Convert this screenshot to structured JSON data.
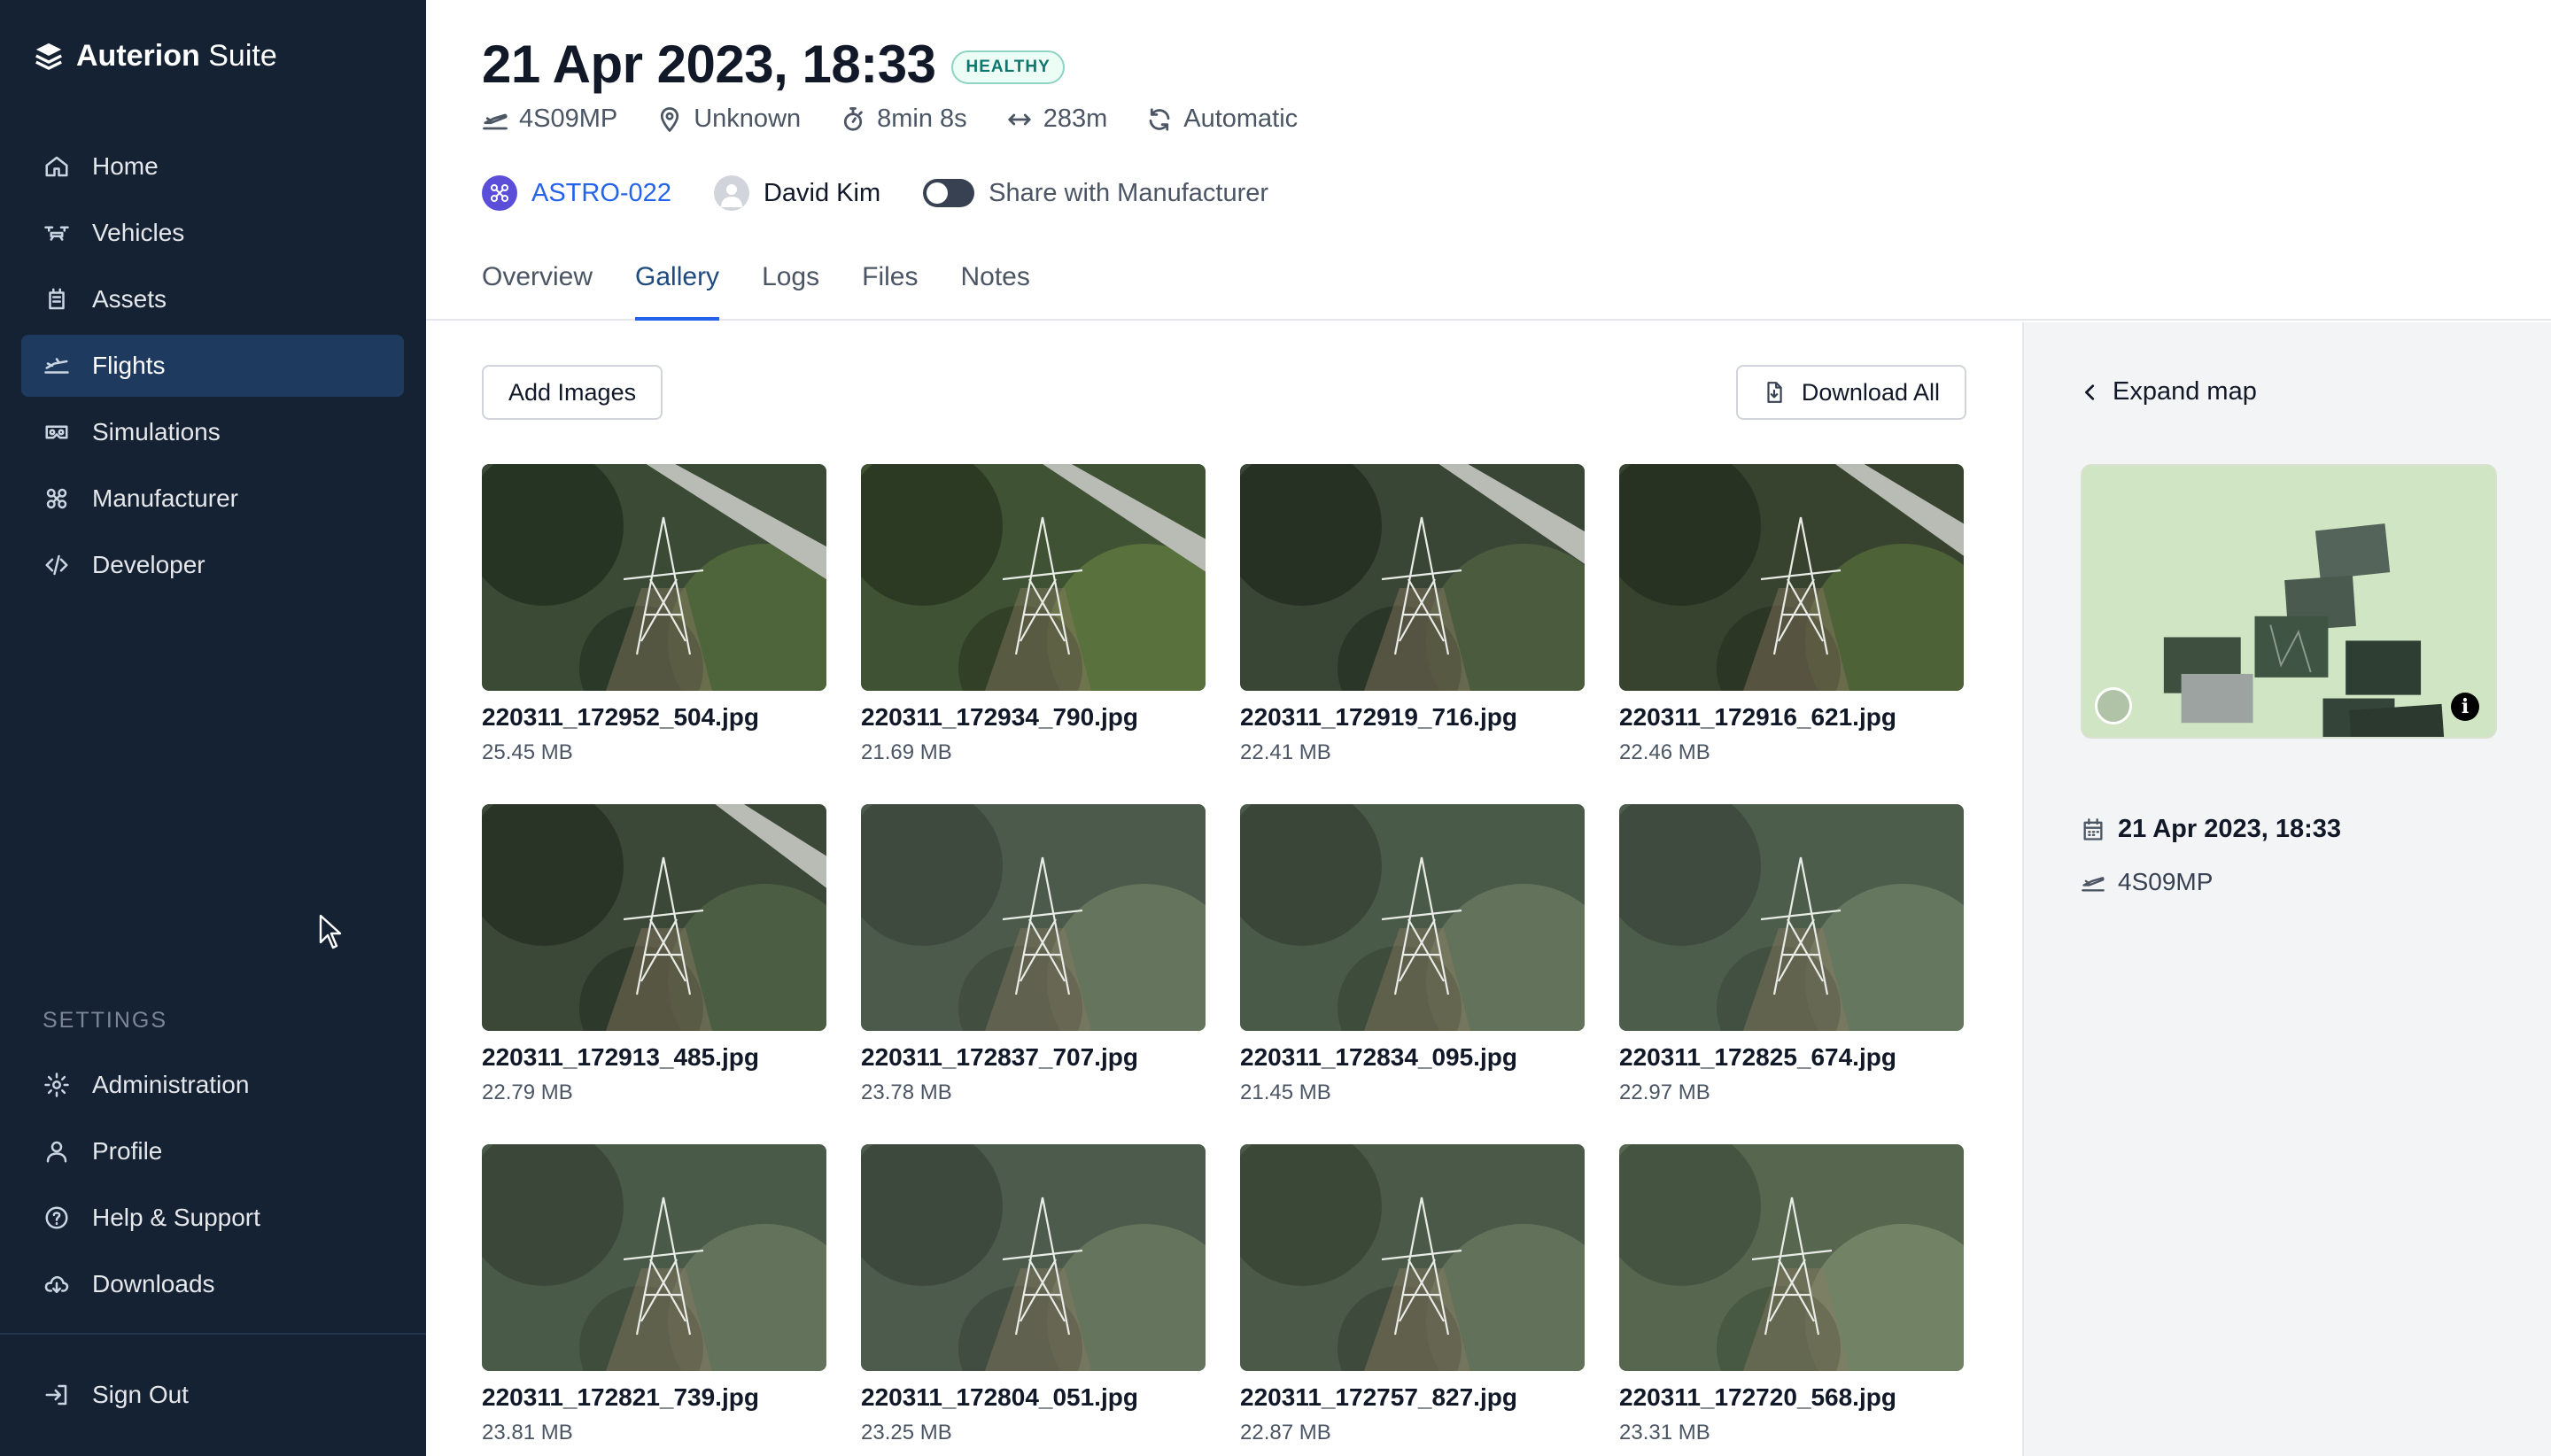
{
  "app": {
    "brand_bold": "Auterion",
    "brand_light": "Suite"
  },
  "sidebar": {
    "main_items": [
      {
        "label": "Home",
        "icon": "home-icon"
      },
      {
        "label": "Vehicles",
        "icon": "drone-icon"
      },
      {
        "label": "Assets",
        "icon": "asset-icon"
      },
      {
        "label": "Flights",
        "icon": "flights-icon",
        "active": true
      },
      {
        "label": "Simulations",
        "icon": "vr-headset-icon"
      },
      {
        "label": "Manufacturer",
        "icon": "grid-icon"
      },
      {
        "label": "Developer",
        "icon": "code-icon"
      }
    ],
    "settings_heading": "SETTINGS",
    "settings_items": [
      {
        "label": "Administration",
        "icon": "gear-icon"
      },
      {
        "label": "Profile",
        "icon": "user-icon"
      },
      {
        "label": "Help & Support",
        "icon": "help-icon"
      },
      {
        "label": "Downloads",
        "icon": "cloud-download-icon"
      }
    ],
    "sign_out": {
      "label": "Sign Out",
      "icon": "sign-out-icon"
    }
  },
  "flight": {
    "title": "21 Apr 2023, 18:33",
    "status": "HEALTHY",
    "meta": {
      "vehicle": "4S09MP",
      "location": "Unknown",
      "duration": "8min 8s",
      "distance": "283m",
      "mode": "Automatic"
    },
    "vehicle_name": "ASTRO-022",
    "pilot": "David Kim",
    "share_label": "Share with Manufacturer",
    "share_enabled": false
  },
  "tabs": [
    {
      "label": "Overview"
    },
    {
      "label": "Gallery",
      "active": true
    },
    {
      "label": "Logs"
    },
    {
      "label": "Files"
    },
    {
      "label": "Notes"
    }
  ],
  "gallery": {
    "add_label": "Add Images",
    "download_label": "Download All",
    "images": [
      {
        "name": "220311_172952_504.jpg",
        "size": "25.45 MB"
      },
      {
        "name": "220311_172934_790.jpg",
        "size": "21.69 MB"
      },
      {
        "name": "220311_172919_716.jpg",
        "size": "22.41 MB"
      },
      {
        "name": "220311_172916_621.jpg",
        "size": "22.46 MB"
      },
      {
        "name": "220311_172913_485.jpg",
        "size": "22.79 MB"
      },
      {
        "name": "220311_172837_707.jpg",
        "size": "23.78 MB"
      },
      {
        "name": "220311_172834_095.jpg",
        "size": "21.45 MB"
      },
      {
        "name": "220311_172825_674.jpg",
        "size": "22.97 MB"
      },
      {
        "name": "220311_172821_739.jpg",
        "size": "23.81 MB"
      },
      {
        "name": "220311_172804_051.jpg",
        "size": "23.25 MB"
      },
      {
        "name": "220311_172757_827.jpg",
        "size": "22.87 MB"
      },
      {
        "name": "220311_172720_568.jpg",
        "size": "23.31 MB"
      }
    ]
  },
  "map_panel": {
    "expand_label": "Expand map",
    "date": "21 Apr 2023, 18:33",
    "vehicle": "4S09MP",
    "info_glyph": "i"
  },
  "colors": {
    "sidebar_bg": "#152233",
    "sidebar_active": "#1e3a5f",
    "accent": "#2563eb",
    "healthy": "#0f766e"
  }
}
